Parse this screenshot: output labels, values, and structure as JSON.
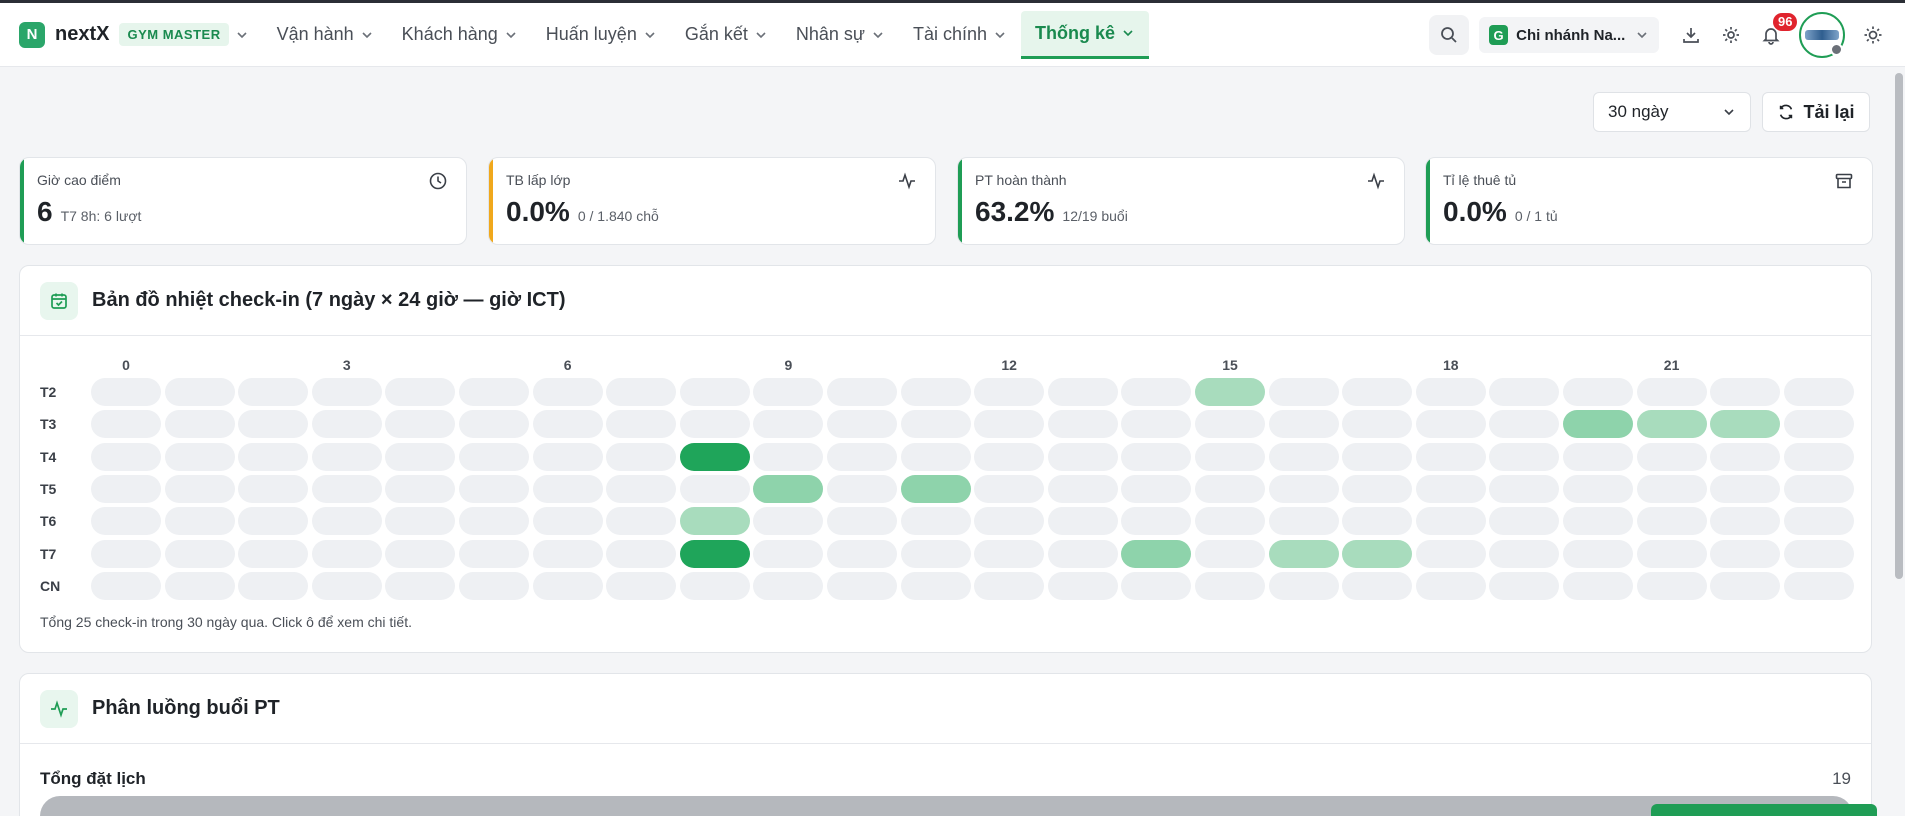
{
  "brand": {
    "logo_letter": "N",
    "name": "nextX",
    "product": "GYM MASTER"
  },
  "nav": [
    {
      "label": "Vận hành"
    },
    {
      "label": "Khách hàng"
    },
    {
      "label": "Huấn luyện"
    },
    {
      "label": "Gắn kết"
    },
    {
      "label": "Nhân sự"
    },
    {
      "label": "Tài chính"
    },
    {
      "label": "Thống kê",
      "active": true
    }
  ],
  "header": {
    "branch_letter": "G",
    "branch_name": "Chi nhánh Na...",
    "notifications": "96"
  },
  "toolbar": {
    "range": "30 ngày",
    "reload_label": "Tải lại"
  },
  "kpis": [
    {
      "title": "Giờ cao điểm",
      "value": "6",
      "sub": "T7 8h: 6 lượt",
      "accent": "#1f9d55",
      "icon": "clock-icon"
    },
    {
      "title": "TB lấp lớp",
      "value": "0.0%",
      "sub": "0 / 1.840 chỗ",
      "accent": "#f0a81c",
      "icon": "activity-icon"
    },
    {
      "title": "PT hoàn thành",
      "value": "63.2%",
      "sub": "12/19 buổi",
      "accent": "#1f9d55",
      "icon": "activity-icon"
    },
    {
      "title": "Tỉ lệ thuê tủ",
      "value": "0.0%",
      "sub": "0 / 1 tủ",
      "accent": "#1f9d55",
      "icon": "archive-icon"
    }
  ],
  "heatmap": {
    "title": "Bản đồ nhiệt check-in (7 ngày × 24 giờ — giờ ICT)",
    "hour_labels": [
      "0",
      "3",
      "6",
      "9",
      "12",
      "15",
      "18",
      "21"
    ],
    "days": [
      "T2",
      "T3",
      "T4",
      "T5",
      "T6",
      "T7",
      "CN"
    ],
    "hours_count": 24,
    "colors": {
      "empty": "#eef0f3",
      "level1": "#a8dcbd",
      "level2": "#8ed3ab",
      "level3": "#1fa55a"
    },
    "cells": [
      {
        "day": 0,
        "hour": 15,
        "level": 1
      },
      {
        "day": 1,
        "hour": 20,
        "level": 2
      },
      {
        "day": 1,
        "hour": 21,
        "level": 1
      },
      {
        "day": 1,
        "hour": 22,
        "level": 1
      },
      {
        "day": 2,
        "hour": 8,
        "level": 3
      },
      {
        "day": 3,
        "hour": 9,
        "level": 2
      },
      {
        "day": 3,
        "hour": 11,
        "level": 2
      },
      {
        "day": 4,
        "hour": 8,
        "level": 1
      },
      {
        "day": 5,
        "hour": 8,
        "level": 3
      },
      {
        "day": 5,
        "hour": 14,
        "level": 2
      },
      {
        "day": 5,
        "hour": 16,
        "level": 1
      },
      {
        "day": 5,
        "hour": 17,
        "level": 1
      }
    ],
    "note": "Tổng 25 check-in trong 30 ngày qua. Click ô để xem chi tiết."
  },
  "pt_panel": {
    "title": "Phân luồng buổi PT",
    "total_label": "Tổng đặt lịch",
    "total_value": "19"
  }
}
